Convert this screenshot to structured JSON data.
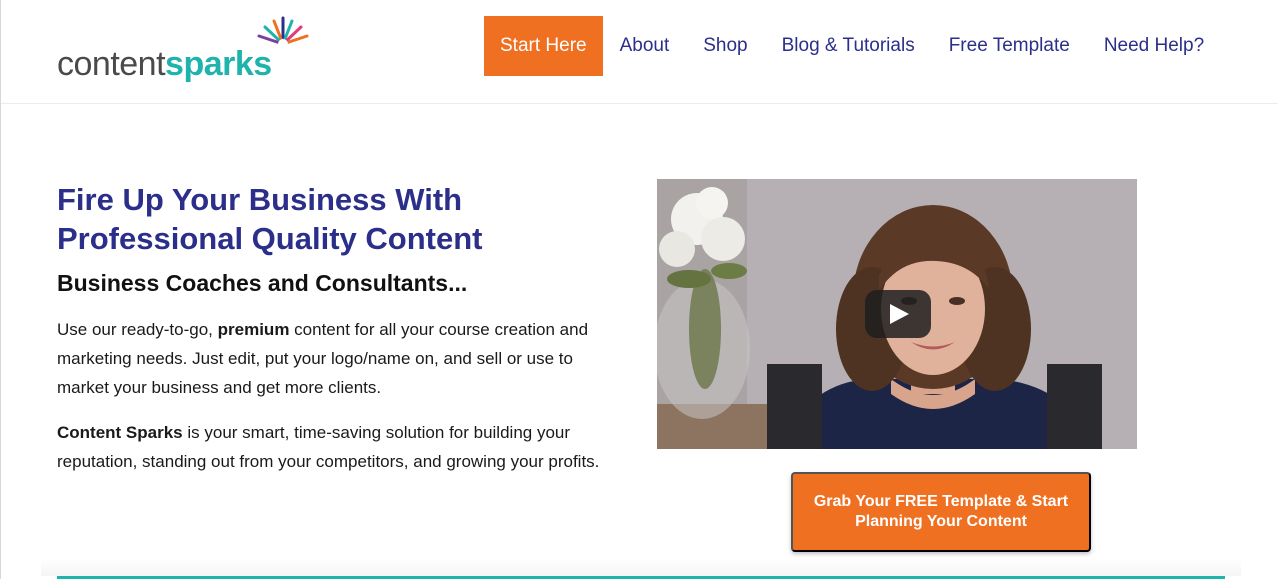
{
  "logo": {
    "part1": "content",
    "part2": "sparks"
  },
  "nav": [
    {
      "label": "Start Here",
      "active": true
    },
    {
      "label": "About"
    },
    {
      "label": "Shop"
    },
    {
      "label": "Blog & Tutorials"
    },
    {
      "label": "Free Template"
    },
    {
      "label": "Need Help?"
    }
  ],
  "hero": {
    "title": "Fire Up Your Business With Professional Quality Content",
    "subtitle": "Business Coaches and Consultants...",
    "p1_before": "Use our ready-to-go, ",
    "p1_bold": "premium",
    "p1_after": " content for all your course creation and marketing needs. Just edit, put your logo/name on, and sell or use to market your business and get more clients.",
    "p2_bold": "Content Sparks",
    "p2_after": " is your smart, time-saving solution for building your reputation, standing out from your competitors, and growing your profits."
  },
  "cta": {
    "label": "Grab Your FREE Template & Start Planning Your Content"
  },
  "colors": {
    "brand_orange": "#f07022",
    "brand_navy": "#2b2f8a",
    "brand_teal": "#1fb3ad"
  },
  "icons": {
    "video_play": "play-icon"
  }
}
